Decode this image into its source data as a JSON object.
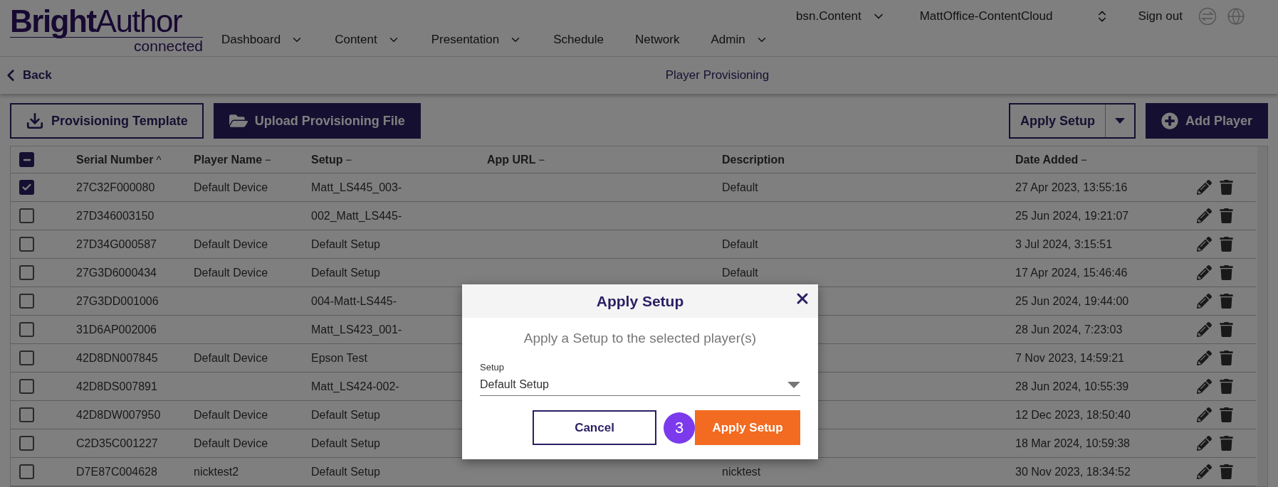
{
  "header": {
    "logo": {
      "name": "**Bright**Author",
      "tagline": "connected"
    },
    "account": {
      "label": "bsn.Content"
    },
    "network": {
      "label": "MattOffice-ContentCloud"
    },
    "sign_out": "Sign out",
    "nav": [
      {
        "label": "Dashboard",
        "has_menu": true
      },
      {
        "label": "Content",
        "has_menu": true
      },
      {
        "label": "Presentation",
        "has_menu": true
      },
      {
        "label": "Schedule",
        "has_menu": false
      },
      {
        "label": "Network",
        "has_menu": false
      },
      {
        "label": "Admin",
        "has_menu": true
      }
    ]
  },
  "subheader": {
    "back": "Back",
    "title": "Player Provisioning"
  },
  "toolbar": {
    "left": [
      {
        "label": "Provisioning Template",
        "kind": "outline"
      },
      {
        "label": "Upload Provisioning File",
        "kind": "filled"
      }
    ],
    "apply_setup": "Apply Setup",
    "add_player": "Add Player"
  },
  "table": {
    "select_all": {
      "mixed": true
    },
    "columns": [
      {
        "label": "Serial Number",
        "sort_mark": "^"
      },
      {
        "label": "Player Name",
        "sort_mark": "−"
      },
      {
        "label": "Setup",
        "sort_mark": "−"
      },
      {
        "label": "App URL",
        "sort_mark": "−"
      },
      {
        "label": "Description"
      },
      {
        "label": "Date Added",
        "sort_mark": "−"
      }
    ],
    "rows": [
      {
        "selected": true,
        "serial": "27C32F000080",
        "player_name": "Default Device",
        "setup": "Matt_LS445_003-",
        "description": "Default",
        "date_added": "27 Apr 2023, 13:55:16"
      },
      {
        "selected": false,
        "serial": "27D346003150",
        "setup": "002_Matt_LS445-",
        "date_added": "25 Jun 2024, 19:21:07"
      },
      {
        "selected": false,
        "serial": "27D34G000587",
        "player_name": "Default Device",
        "setup": "Default Setup",
        "description": "Default",
        "date_added": "3 Jul 2024, 3:15:51"
      },
      {
        "selected": false,
        "serial": "27G3D6000434",
        "player_name": "Default Device",
        "setup": "Default Setup",
        "description": "Default",
        "date_added": "17 Apr 2024, 15:46:46"
      },
      {
        "selected": false,
        "serial": "27G3DD001006",
        "setup": "004-Matt-LS445-",
        "date_added": "25 Jun 2024, 19:44:00"
      },
      {
        "selected": false,
        "serial": "31D6AP002006",
        "setup": "Matt_LS423_001-",
        "date_added": "28 Jun 2024, 7:23:03"
      },
      {
        "selected": false,
        "serial": "42D8DN007845",
        "player_name": "Default Device",
        "setup": "Epson Test",
        "date_added": "7 Nov 2023, 14:59:21"
      },
      {
        "selected": false,
        "serial": "42D8DS007891",
        "setup": "Matt_LS424-002-",
        "date_added": "28 Jun 2024, 10:55:39"
      },
      {
        "selected": false,
        "serial": "42D8DW007950",
        "player_name": "Default Device",
        "setup": "Default Setup",
        "date_added": "12 Dec 2023, 18:50:40"
      },
      {
        "selected": false,
        "serial": "C2D35C001227",
        "player_name": "Default Device",
        "setup": "Default Setup",
        "date_added": "18 Mar 2024, 10:59:38"
      },
      {
        "selected": false,
        "serial": "D7E87C004628",
        "player_name": "nicktest2",
        "setup": "Default Setup",
        "description": "nicktest",
        "date_added": "30 Nov 2023, 18:34:52"
      }
    ]
  },
  "modal": {
    "title": "Apply Setup",
    "message": "Apply a Setup to the selected player(s)",
    "field_label": "Setup",
    "field_value": "Default Setup",
    "cancel": "Cancel",
    "confirm": "Apply Setup",
    "step_badge": "3"
  }
}
